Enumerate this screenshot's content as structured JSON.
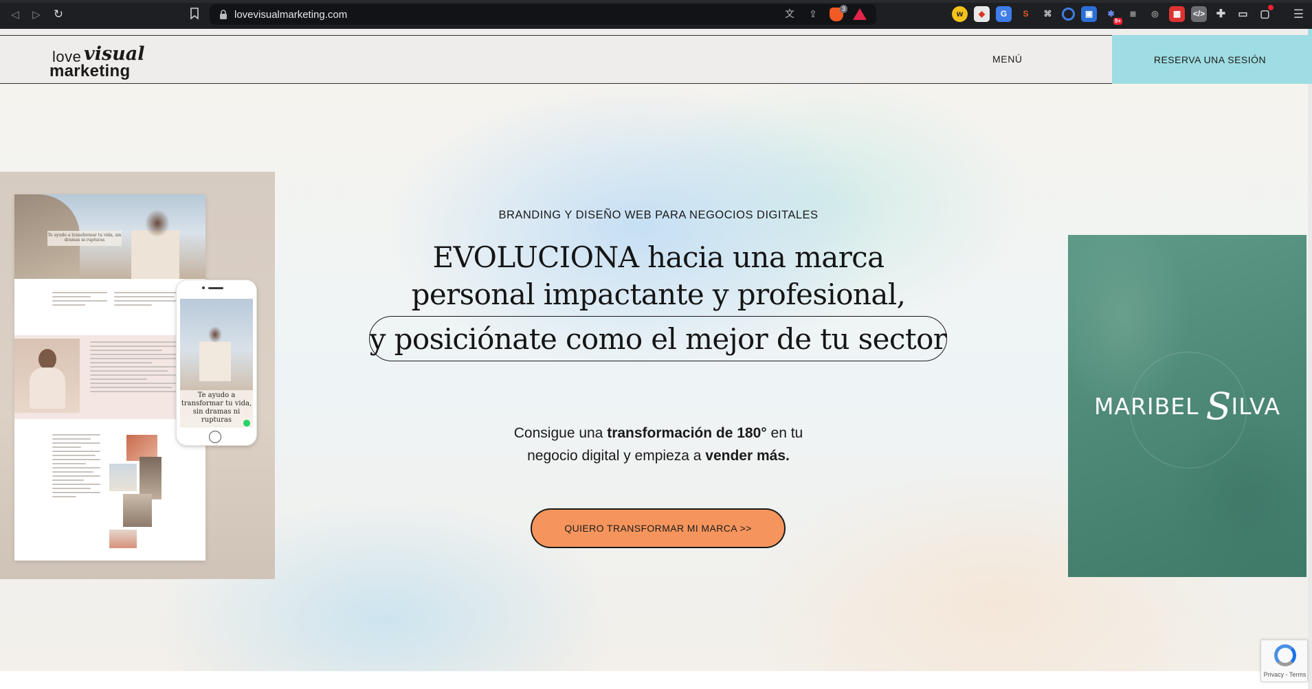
{
  "browser": {
    "url": "lovevisualmarketing.com",
    "brave_shield_count": "3",
    "icons": [
      "back-icon",
      "forward-icon",
      "reload-icon",
      "bookmark-icon",
      "lock-icon",
      "translate-icon",
      "share-icon",
      "brave-shield-icon",
      "brave-rewards-icon",
      "extensions-icon",
      "sidebar-icon",
      "wallet-icon",
      "menu-icon"
    ],
    "extension_badge": "9+"
  },
  "header": {
    "logo_love": "love",
    "logo_visual": "visual",
    "logo_marketing": "marketing",
    "menu_label": "MENÚ",
    "reserva_label": "RESERVA UNA SESIÓN",
    "accent_color": "#9edde3"
  },
  "hero": {
    "eyebrow": "BRANDING Y DISEÑO WEB PARA NEGOCIOS DIGITALES",
    "headline_line1": "EVOLUCIONA hacia una marca",
    "headline_line2": "personal impactante y profesional,",
    "headline_pill": "y posiciónate como el mejor de tu sector",
    "sub_part1": "Consigue una ",
    "sub_bold1": "transformación de 180°",
    "sub_part2": " en tu",
    "sub_part3": "negocio digital y empieza a ",
    "sub_bold2": "vender más.",
    "cta_label": "QUIERO TRANSFORMAR MI MARCA >>",
    "cta_color": "#f5955d"
  },
  "mockup": {
    "desktop_caption": "Te ayudo a transformar tu vida, sin dramas ni rupturas",
    "phone_caption_l1": "Te ayudo a",
    "phone_caption_l2": "transformar tu vida,",
    "phone_caption_l3": "sin dramas ni",
    "phone_caption_l4": "rupturas"
  },
  "card": {
    "name_first": "MARIBEL",
    "name_s": "S",
    "name_rest": "ILVA",
    "color": "#4f8a78"
  },
  "recaptcha": {
    "text": "Privacy - Terms"
  }
}
